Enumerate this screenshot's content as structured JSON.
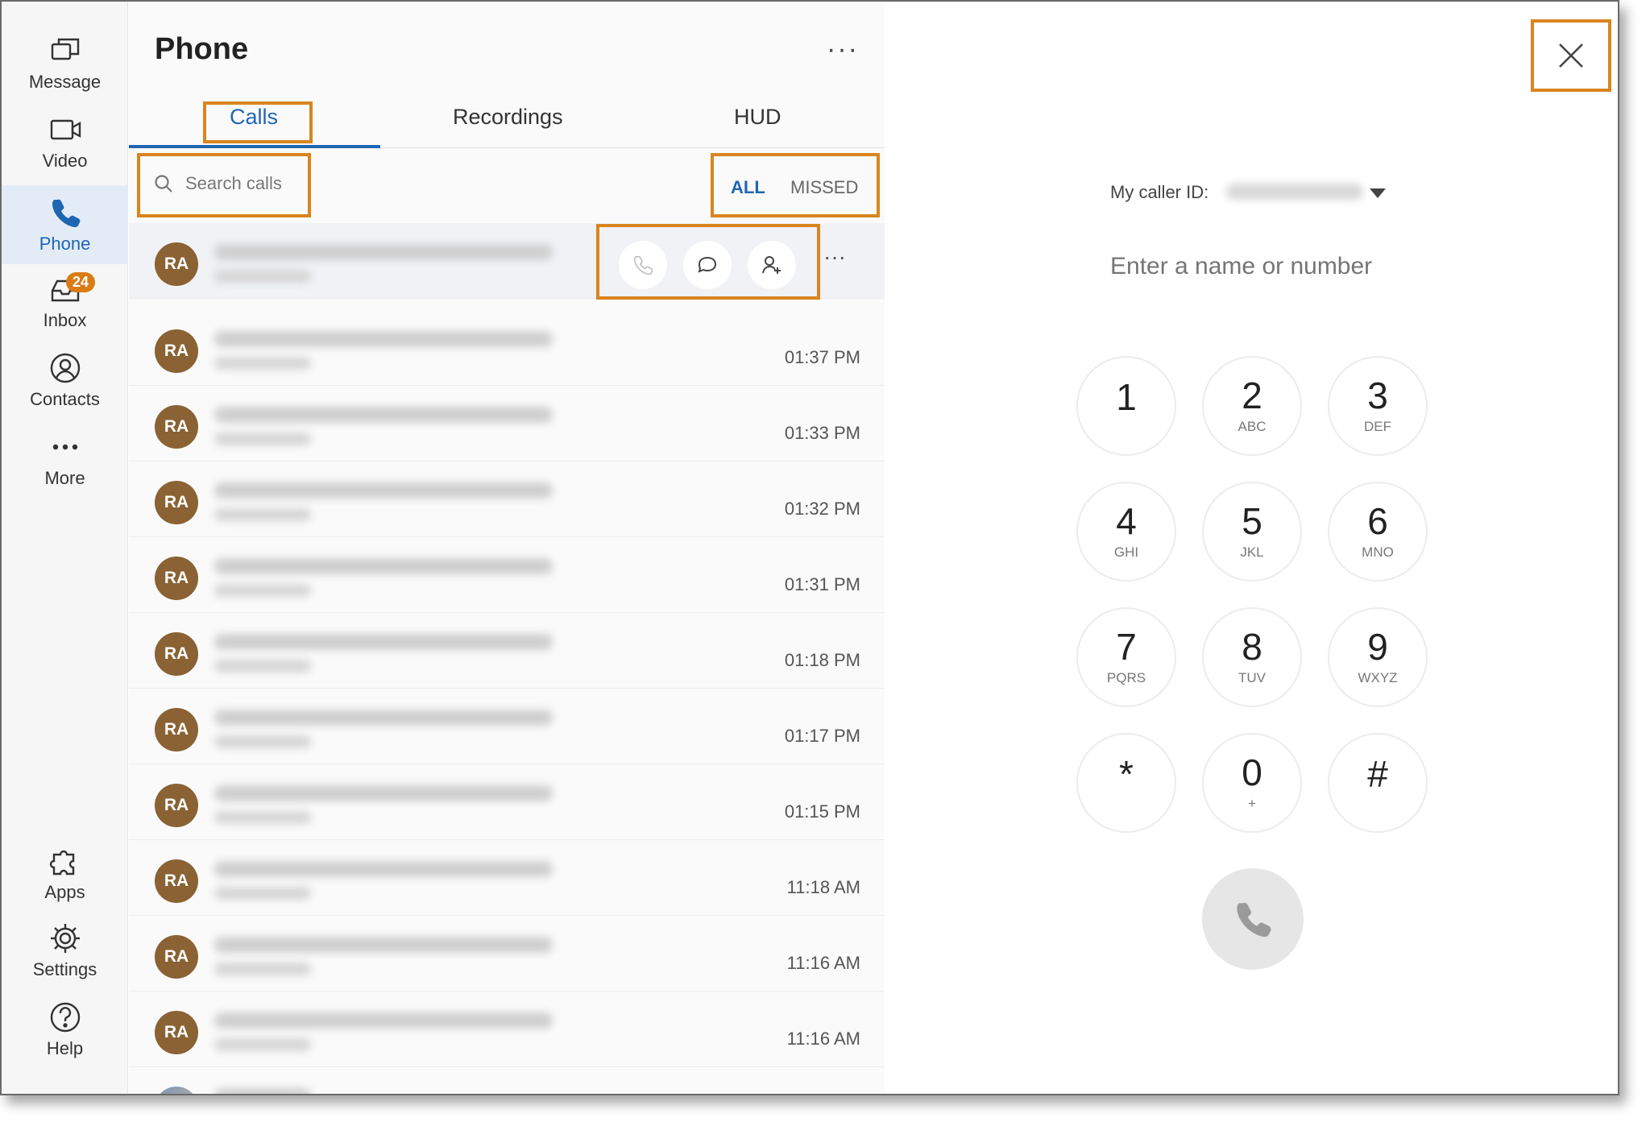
{
  "nav": {
    "items": [
      {
        "label": "Message",
        "icon": "message-icon"
      },
      {
        "label": "Video",
        "icon": "video-icon"
      },
      {
        "label": "Phone",
        "icon": "phone-icon",
        "active": true
      },
      {
        "label": "Inbox",
        "icon": "inbox-icon",
        "badge": "24"
      },
      {
        "label": "Contacts",
        "icon": "contacts-icon"
      },
      {
        "label": "More",
        "icon": "more-icon"
      },
      {
        "label": "Apps",
        "icon": "apps-icon"
      },
      {
        "label": "Settings",
        "icon": "settings-icon"
      },
      {
        "label": "Help",
        "icon": "help-icon"
      }
    ]
  },
  "panel": {
    "title": "Phone",
    "more": "···",
    "tabs": [
      {
        "label": "Calls",
        "active": true
      },
      {
        "label": "Recordings"
      },
      {
        "label": "HUD"
      }
    ],
    "search_placeholder": "Search calls",
    "filters": {
      "all": "ALL",
      "missed": "MISSED"
    },
    "row_more": "···",
    "calls": [
      {
        "initials": "RA",
        "time": ""
      },
      {
        "initials": "RA",
        "time": "01:37 PM"
      },
      {
        "initials": "RA",
        "time": "01:33 PM"
      },
      {
        "initials": "RA",
        "time": "01:32 PM"
      },
      {
        "initials": "RA",
        "time": "01:31 PM"
      },
      {
        "initials": "RA",
        "time": "01:18 PM"
      },
      {
        "initials": "RA",
        "time": "01:17 PM"
      },
      {
        "initials": "RA",
        "time": "01:15 PM"
      },
      {
        "initials": "RA",
        "time": "11:18 AM"
      },
      {
        "initials": "RA",
        "time": "11:16 AM"
      },
      {
        "initials": "RA",
        "time": "11:16 AM"
      },
      {
        "initials": "",
        "time": ""
      }
    ]
  },
  "dialer": {
    "caller_id_label": "My caller ID:",
    "input_placeholder": "Enter a name or number",
    "keys": [
      {
        "digit": "1",
        "letters": ""
      },
      {
        "digit": "2",
        "letters": "ABC"
      },
      {
        "digit": "3",
        "letters": "DEF"
      },
      {
        "digit": "4",
        "letters": "GHI"
      },
      {
        "digit": "5",
        "letters": "JKL"
      },
      {
        "digit": "6",
        "letters": "MNO"
      },
      {
        "digit": "7",
        "letters": "PQRS"
      },
      {
        "digit": "8",
        "letters": "TUV"
      },
      {
        "digit": "9",
        "letters": "WXYZ"
      },
      {
        "digit": "*",
        "letters": ""
      },
      {
        "digit": "0",
        "letters": "+"
      },
      {
        "digit": "#",
        "letters": ""
      }
    ]
  },
  "colors": {
    "accent": "#1f66b2",
    "highlight": "#d9851f",
    "avatar": "#8a6233",
    "badge": "#d97c14"
  }
}
